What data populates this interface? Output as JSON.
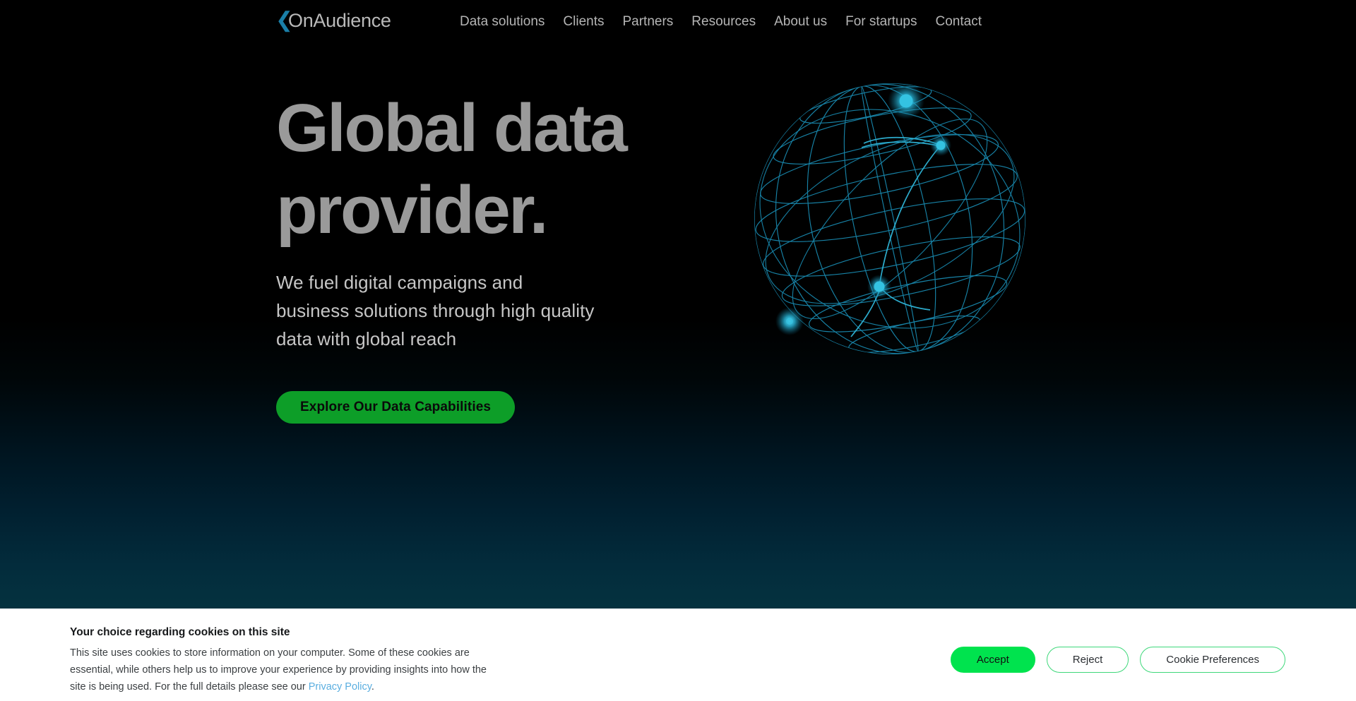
{
  "header": {
    "brand": {
      "chevron": "❮",
      "name": "OnAudience"
    },
    "nav_items": [
      {
        "label": "Data solutions"
      },
      {
        "label": "Clients"
      },
      {
        "label": "Partners"
      },
      {
        "label": "Resources"
      },
      {
        "label": "About us"
      },
      {
        "label": "For startups"
      },
      {
        "label": "Contact"
      }
    ]
  },
  "hero": {
    "title": "Global data\nprovider.",
    "subtitle": "We fuel digital campaigns and business solutions through high quality data with global reach",
    "cta_label": "Explore Our Data Capabilities",
    "graphic": "wireframe-globe"
  },
  "cookie_banner": {
    "title": "Your choice regarding cookies on this site",
    "body_before_link": "This site uses cookies to store information on your computer. Some of these cookies are essential, while others help us to improve your experience by providing insights into how the site is being used. For the full details please see our ",
    "link_label": "Privacy Policy",
    "body_after_link": ".",
    "accept_label": "Accept",
    "reject_label": "Reject",
    "preferences_label": "Cookie Preferences"
  },
  "colors": {
    "background": "#000000",
    "hero_gradient_end": "#04323f",
    "brand_chevron": "#1a7fa8",
    "heading_text": "#9a9a9a",
    "nav_text": "#b5b5b5",
    "cta_green": "#0d9e28",
    "globe_line": "#1a8eb5",
    "globe_node": "#29b6d8",
    "accept_green": "#00e34e",
    "outline_green": "#3ed87a",
    "cookie_link_blue": "#5aaee0"
  }
}
